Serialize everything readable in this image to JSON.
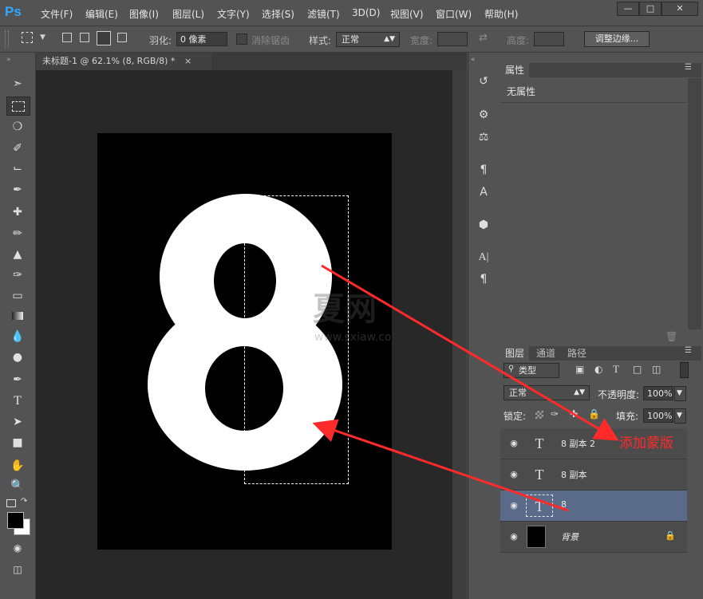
{
  "app": {
    "logo": "Ps"
  },
  "menus": [
    "文件(F)",
    "编辑(E)",
    "图像(I)",
    "图层(L)",
    "文字(Y)",
    "选择(S)",
    "滤镜(T)",
    "3D(D)",
    "视图(V)",
    "窗口(W)",
    "帮助(H)"
  ],
  "options": {
    "feather_label": "羽化:",
    "feather_value": "0 像素",
    "antialias_label": "消除锯齿",
    "style_label": "样式:",
    "style_value": "正常",
    "width_label": "宽度:",
    "height_label": "高度:",
    "refine_edge": "调整边缘..."
  },
  "document": {
    "tab_title": "未标题-1 @ 62.1% (8, RGB/8) *",
    "canvas_glyph": "8",
    "watermark_cn": "夏网",
    "watermark_url": "www.sxiaw.com"
  },
  "properties": {
    "tab": "属性",
    "content": "无属性"
  },
  "layers_panel": {
    "tabs": [
      "图层",
      "通道",
      "路径"
    ],
    "kind_filter": "类型",
    "blend_mode": "正常",
    "opacity_label": "不透明度:",
    "opacity_value": "100%",
    "lock_label": "锁定:",
    "fill_label": "填充:",
    "fill_value": "100%",
    "layers": [
      {
        "name": "8 副本 2",
        "type": "text",
        "selected": false
      },
      {
        "name": "8 副本",
        "type": "text",
        "selected": false
      },
      {
        "name": "8",
        "type": "text",
        "selected": true
      },
      {
        "name": "背景",
        "type": "background",
        "selected": false
      }
    ]
  },
  "annotation": {
    "text": "添加蒙版",
    "color": "#ff2a2a"
  },
  "colors": {
    "selected_layer": "#596b88",
    "canvas": "#000000",
    "workspace": "#282828"
  }
}
